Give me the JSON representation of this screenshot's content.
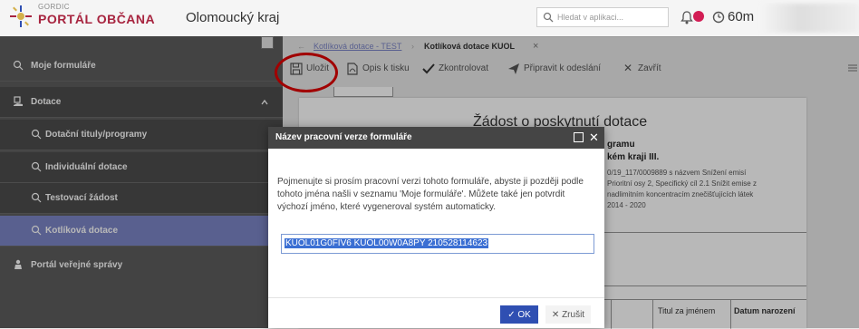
{
  "header": {
    "logo_small": "GORDIC",
    "logo_big": "PORTÁL OBČANA",
    "tenant": "Olomoucký kraj",
    "search_placeholder": "Hledat v aplikaci...",
    "notifications_count": "",
    "timer": "60m"
  },
  "sidebar": {
    "items": [
      {
        "label": "Moje formuláře"
      },
      {
        "label": "Dotace"
      },
      {
        "label": "Dotační tituly/programy"
      },
      {
        "label": "Individuální dotace"
      },
      {
        "label": "Testovací žádost"
      },
      {
        "label": "Kotlíková dotace"
      },
      {
        "label": "Portál veřejné správy"
      }
    ]
  },
  "breadcrumb": {
    "parent": "Kotlíková dotace - TEST",
    "current": "Kotlíková dotace KUOL"
  },
  "toolbar": {
    "save": "Uložit",
    "print": "Opis k tisku",
    "check": "Zkontrolovat",
    "prepare": "Připravit k odeslání",
    "close": "Zavřít"
  },
  "document": {
    "title": "Žádost o poskytnutí dotace",
    "line1": "gramu",
    "line2": "kém kraji III.",
    "small1": "0/19_117/0009889 s názvem Snížení emisí",
    "small2": "Prioritní osy 2, Specifický cíl 2.1 Snížit emise z",
    "small3": "nadlimitním koncentracím znečišťujících látek",
    "small4": "2014 - 2020",
    "col_title": "Titul za jménem",
    "col_birth": "Datum narození"
  },
  "dialog": {
    "title": "Název pracovní verze formuláře",
    "text": "Pojmenujte si prosím pracovní verzi tohoto formuláře, abyste ji později podle tohoto jména našli v seznamu 'Moje formuláře'. Můžete také jen potvrdit výchozí jméno, které vygeneroval systém automaticky.",
    "input_value": "KUOL01G0FIV6 KUOL00W0A8PY 210528114623",
    "ok": "OK",
    "cancel": "Zrušit"
  },
  "colors": {
    "accent": "#7c85c6",
    "brand": "#a7243f",
    "sidebar": "#5d5d5d",
    "primary_button": "#2f4fb2",
    "highlight_circle": "#e00000"
  }
}
